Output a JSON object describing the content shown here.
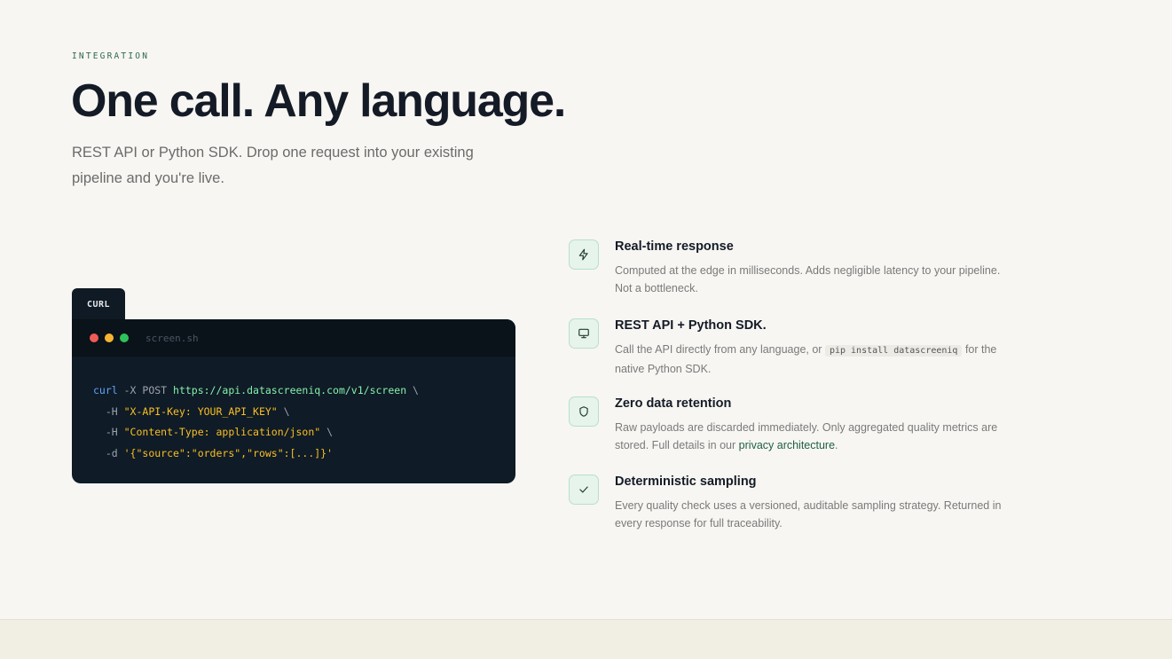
{
  "eyebrow": "INTEGRATION",
  "headline": "One call. Any language.",
  "subtitle": "REST API or Python SDK. Drop one request into your existing pipeline and you're live.",
  "code": {
    "tab_label": "CURL",
    "filename": "screen.sh",
    "lines": [
      {
        "cmd": "curl",
        "args": " -X POST ",
        "url": "https://api.datascreeniq.com/v1/screen",
        "tail": " \\"
      },
      {
        "pre": "  -H ",
        "str": "\"X-API-Key: YOUR_API_KEY\"",
        "tail": " \\"
      },
      {
        "pre": "  -H ",
        "str": "\"Content-Type: application/json\"",
        "tail": " \\"
      },
      {
        "pre": "  -d ",
        "str": "'{\"source\":\"orders\",\"rows\":[...]}'",
        "tail": ""
      }
    ]
  },
  "features": [
    {
      "icon": "lightning-icon",
      "title": "Real-time response",
      "desc": "Computed at the edge in milliseconds. Adds negligible latency to your pipeline. Not a bottleneck."
    },
    {
      "icon": "monitor-icon",
      "title": "REST API + Python SDK.",
      "desc_before": "Call the API directly from any language, or",
      "desc_code": "pip install datascreeniq",
      "desc_after": "for the native Python SDK."
    },
    {
      "icon": "shield-icon",
      "title": "Zero data retention",
      "desc_before": "Raw payloads are discarded immediately. Only aggregated quality metrics are stored. Full details in our",
      "desc_link": "privacy architecture",
      "desc_after": "."
    },
    {
      "icon": "check-icon",
      "title": "Deterministic sampling",
      "desc": "Every quality check uses a versioned, auditable sampling strategy. Returned in every response for full traceability."
    }
  ],
  "colors": {
    "background": "#f7f6f3",
    "accent": "#2f6b4f",
    "code_bg": "#0f1b26"
  }
}
